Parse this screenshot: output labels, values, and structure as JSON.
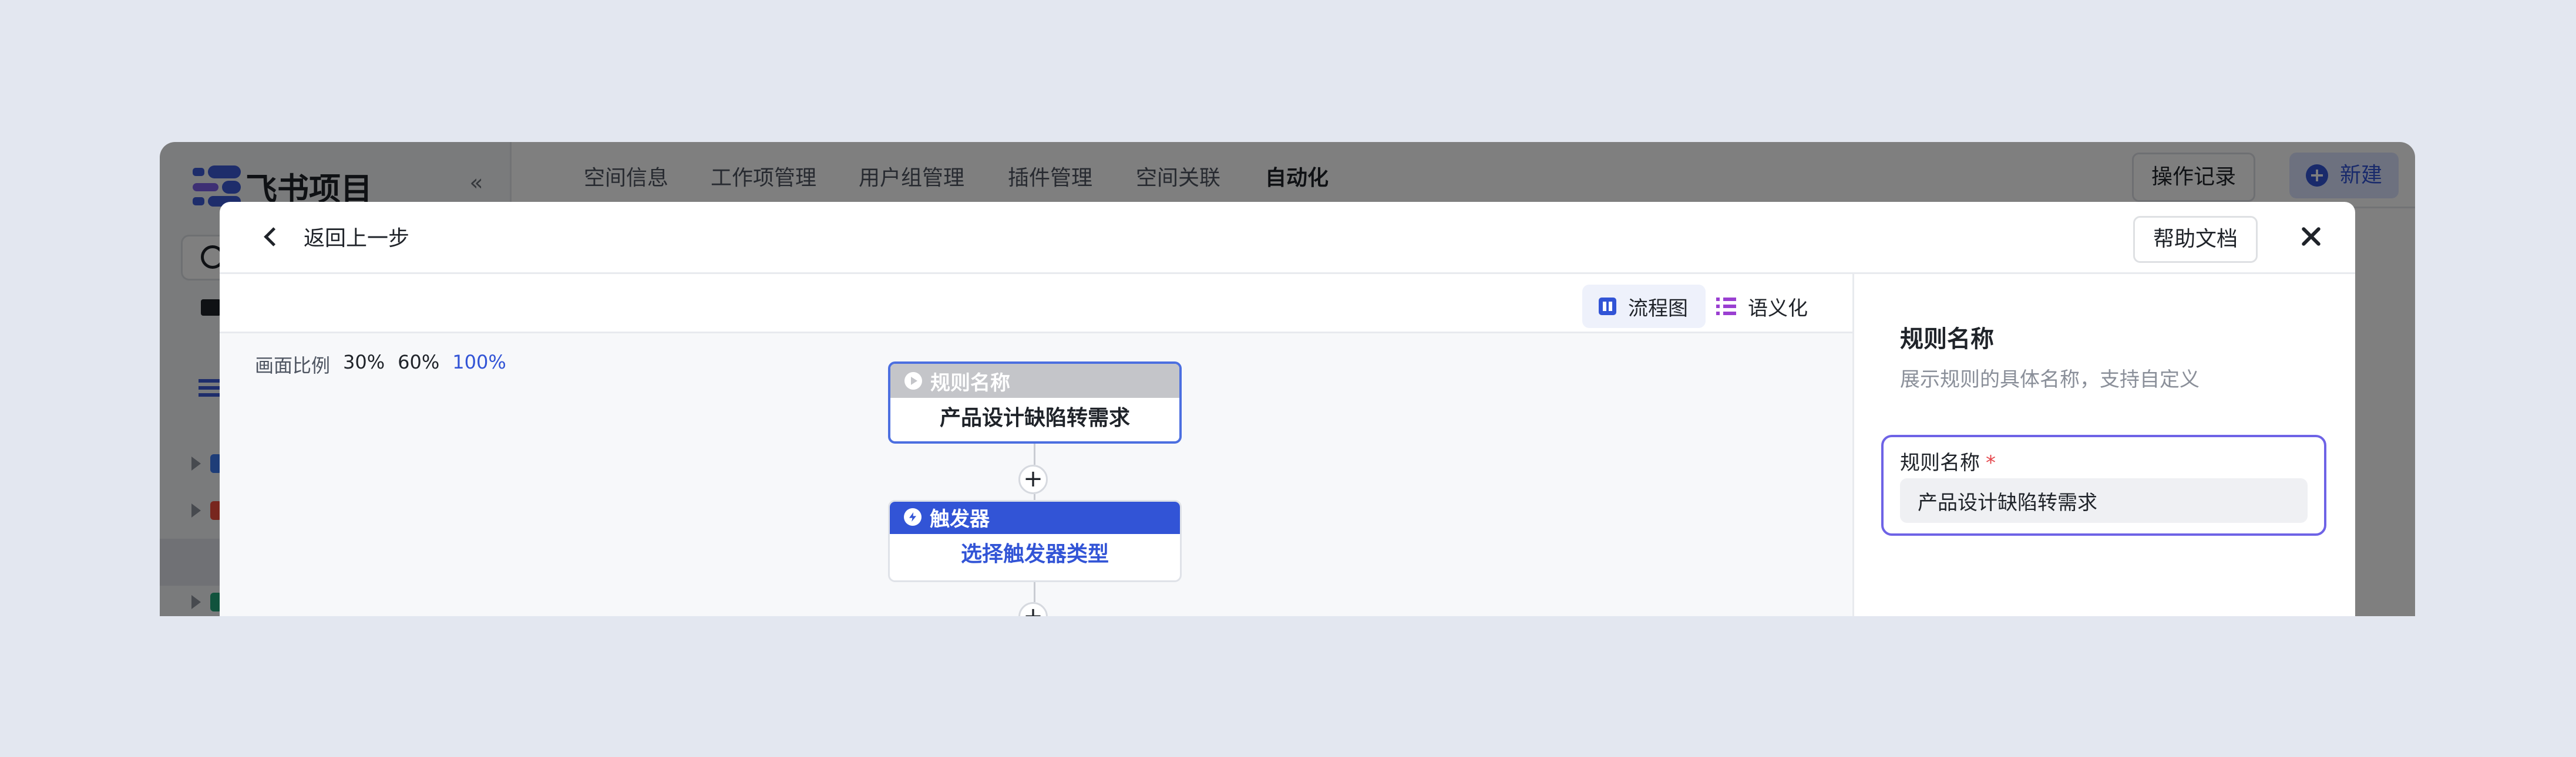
{
  "app": {
    "logo_text": "飞书项目",
    "nav_tabs": [
      "空间信息",
      "工作项管理",
      "用户组管理",
      "插件管理",
      "空间关联",
      "自动化"
    ],
    "active_tab": "自动化",
    "ops_button": "操作记录",
    "new_button": "新建"
  },
  "modal": {
    "back_label": "返回上一步",
    "help_button": "帮助文档",
    "views": {
      "flowchart": "流程图",
      "semantic": "语义化"
    },
    "zoom": {
      "label": "画面比例",
      "options": [
        "30%",
        "60%",
        "100%"
      ],
      "active": "100%"
    },
    "nodes": {
      "rule_name": {
        "title": "规则名称",
        "value": "产品设计缺陷转需求"
      },
      "trigger": {
        "title": "触发器",
        "value": "选择触发器类型"
      }
    },
    "panel": {
      "title": "规则名称",
      "description": "展示规则的具体名称，支持自定义",
      "field_label": "规则名称",
      "required_mark": "*",
      "field_value": "产品设计缺陷转需求"
    }
  },
  "colors": {
    "accent": "#3254d6",
    "focus_border": "#6e63e6",
    "required": "#e5484d",
    "overlay": "rgba(0,0,0,0.5)"
  }
}
